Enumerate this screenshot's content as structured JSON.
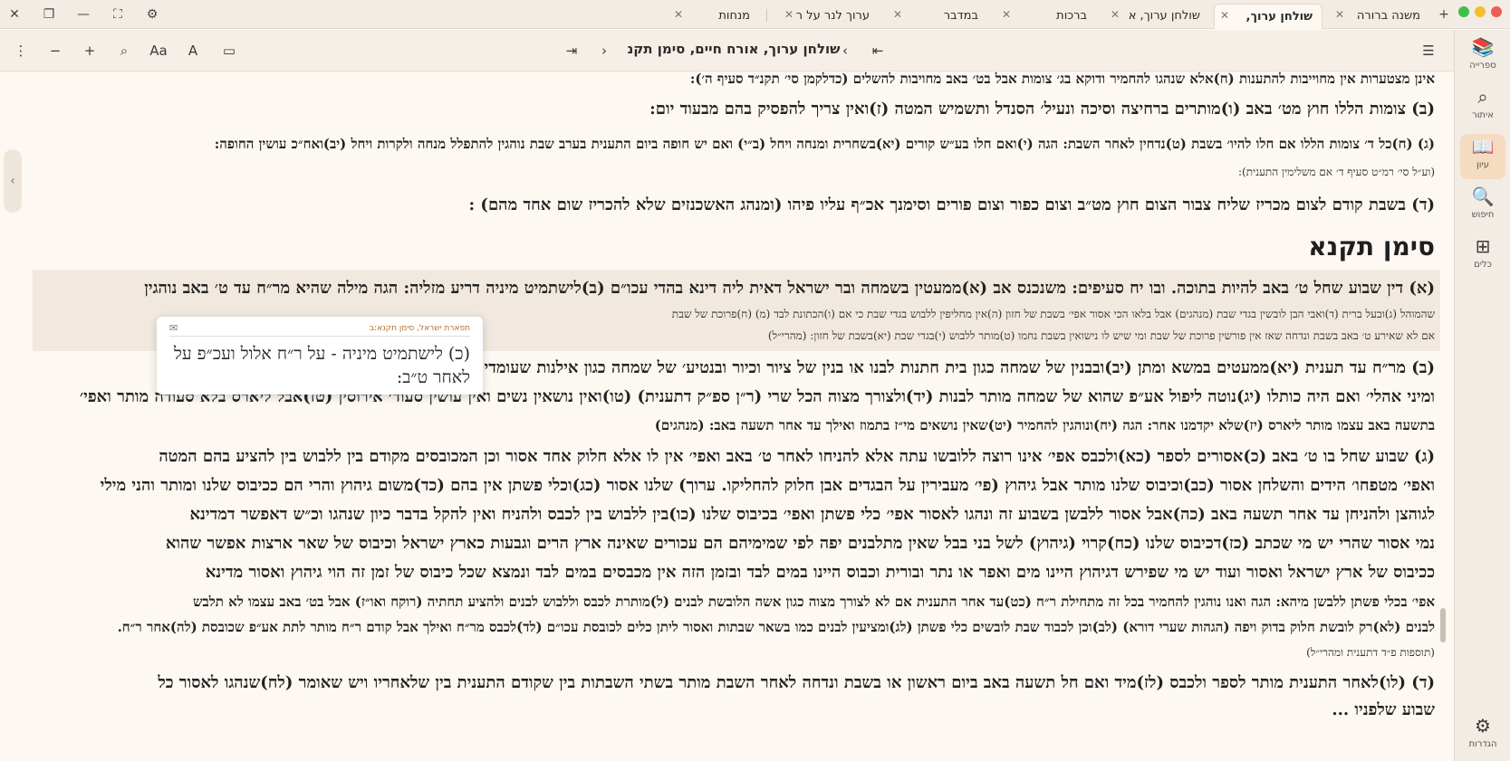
{
  "tabs": [
    {
      "label": "משנה ברורה",
      "close": "✕"
    },
    {
      "label": "שולחן ערוך,",
      "close": "✕",
      "active": true
    },
    {
      "label": "שולחן ערוך, א",
      "close": "✕"
    },
    {
      "label": "ברכות",
      "close": "✕"
    },
    {
      "label": "במדבר",
      "close": "✕"
    },
    {
      "label": "ערוך לנר על ר",
      "close": "✕"
    },
    {
      "label": "מנחות",
      "close": "✕"
    }
  ],
  "window_icons": {
    "add": "+",
    "settings": "⚙",
    "close": "✕",
    "minimize": "—",
    "fullscreen": "⛶",
    "restore": "❐"
  },
  "toolbar": {
    "book_title": "שולחן ערוך, אורח חיים, סימן תקנ",
    "menu_icon": "☰",
    "first": "⇤",
    "prev": "‹",
    "next": "›",
    "last": "⇥",
    "more": "⋮",
    "zoom_out": "−",
    "zoom_in": "+",
    "search": "⌕",
    "font_a": "Aa",
    "font_b": "A",
    "panel": "▭"
  },
  "rightbar": [
    {
      "icon": "📚",
      "label": "ספרייה"
    },
    {
      "icon": "⌕",
      "label": "איתור"
    },
    {
      "icon": "📖",
      "label": "עיון",
      "active": true
    },
    {
      "icon": "🔍",
      "label": "חיפוש"
    },
    {
      "icon": "⊞",
      "label": "כלים"
    },
    {
      "icon": "⚙",
      "label": "הגדרות"
    }
  ],
  "content": {
    "lines": [
      {
        "text": "אינן מצטערות אין מחוייבות להתענות (ח)אלא שנהגו להחמיר ודוקא בג׳ צומות אבל בט׳ באב מחויבות להשלים (כדלקמן סי׳ תקנ״ד סעיף ה׳):",
        "cls": "mid"
      },
      {
        "text": "(ב) צומות הללו חוץ מט׳ באב (ו)מותרים ברחיצה וסיכה ונעיל׳ הסנדל ותשמיש המטה (ז)ואין צריך להפסיק בהם מבעוד יום:",
        "cls": ""
      },
      {
        "text": "(ג) (ח)כל ד׳ צומות הללו אם חלו להיו׳ בשבת (ט)נדחין לאחר השבת: הגה (י)ואם חלו בע״ש קורים (יא)בשחרית ומנחה ויחל (ב״י) ואם יש חופה ביום התענית בערב שבת נוהגין להתפלל מנחה ולקרות ויחל (יב)ואח״כ עושין החופה:",
        "cls": "mid"
      },
      {
        "text": "(וע״ל סי׳ רמ״ט סעיף ד׳ אם משלימין התענית):",
        "cls": "small"
      },
      {
        "text": "(ד) בשבת קודם לצום מכריז שליח צבור הצום חוץ מט״ב וצום כפור וצום פורים וסימנך אכ״ף עליו פיהו (ומנהג האשכנזים שלא להכריז שום אחד מהם) :",
        "cls": ""
      },
      {
        "text": "(א) דין שבוע שחל ט׳ באב להיות בתוכה. ובו יח סעיפים: משנכנס אב (א)ממעטין בשמחה ובר ישראל דאית ליה דינא בהדי עכו״ם (ב)לישתמיט מיניה דריע מזליה: הגה מילה שהיא מר״ח עד ט׳ באב נוהגין",
        "cls": ""
      },
      {
        "text": "שהמוהל (ג)ובעל ברית (ד)ואבי הבן לובשין בגדי שבת (מנהגים) אבל בלאו הכי אסור אפי׳ בשבת של חזון (ה)אין מחליפין ללבוש בגדי שבת כי אם (ו)הכתונת לבד (מ) (ח)פרוכת של שבת",
        "cls": "small"
      },
      {
        "text": "אם לא שאירע ט׳ באב בשבת ונדחה שאז אין פורשין פרוכת של שבת ומי שיש לו נישואין בשבת נחמו (ט)מותר ללבוש (י)בגדי שבת (יא)בשבת של חזון: (מהרי״ל)",
        "cls": "small"
      },
      {
        "text": "(ב) מר״ח עד תענית (יא)ממעטים במשא ומתן (יב)ובבנין של שמחה כגון בית חתנות לבנו או בנין של ציור וכיור ובנטיע׳ של שמחה כגון אילנות שעומדים לצל או לטבע כגון הדס צילו או מיני הדס",
        "cls": ""
      },
      {
        "text": "ומיני אהלי׳ ואם היה כותלו (יג)נוטה ליפול אע״פ שהוא של שמחה מותר לבנות (יד)ולצורך מצוה הכל שרי (ר״ן ספ״ק דתענית) (טו)ואין נושאין נשים ואין עושין סעוד׳ אירוסין (טז)אבל ליארס בלא סעודה מותר ואפי׳",
        "cls": ""
      },
      {
        "text": "בתשעה באב עצמו מותר ליארס (יז)שלא יקדמנו אחר: הגה (יח)ונוהגין להחמיר (יט)שאין נושאים מי״ז בתמוז ואילך עד אחר תשעה באב: (מנהגים)",
        "cls": "mid"
      },
      {
        "text": "(ג) שבוע שחל בו ט׳ באב (כ)אסורים לספר (כא)ולכבס אפי׳ אינו רוצה ללובשו עתה אלא להניחו לאחר ט׳ באב ואפי׳ אין לו אלא חלוק אחד אסור וכן המכובסים מקודם בין ללבוש בין להציע בהם המטה",
        "cls": ""
      },
      {
        "text": "ואפי׳ מטפחו׳ הידים והשלחן אסור (כב)וכיבוס שלנו מותר אבל גיהוץ (פי׳ מעבירין על הבגדים אבן חלוק להחליקו. ערוך) שלנו אסור (כג)וכלי פשתן אין בהם (כד)משום גיהוץ והרי הם ככיבוס שלנו ומותר והני מילי",
        "cls": ""
      },
      {
        "text": "לגוהצן ולהניחן עד אחר תשעה באב (כה)אבל אסור ללבשן בשבוע זה ונהגו לאסור אפי׳ כלי פשתן ואפי׳ בכיבוס שלנו (כו)בין ללבוש בין לכבס ולהניח ואין להקל בדבר כיון שנהגו וכ״ש דאפשר דמדינא",
        "cls": ""
      },
      {
        "text": "נמי אסור שהרי יש מי שכתב (כז)דכיבוס שלנו (כח)קרוי (גיהוץ) לשל בני בבל שאין מתלבנים יפה לפי שמימיהם הם עכורים שאינה ארץ הרים וגבעות כארץ ישראל וכיבוס של שאר ארצות אפשר שהוא",
        "cls": ""
      },
      {
        "text": "ככיבוס של ארץ ישראל ואסור ועוד יש מי שפירש דגיהוץ היינו מים ואפר או נתר ובורית וכבוס היינו במים לבד ובזמן הזה אין מכבסים במים לבד ונמצא שכל כיבוס של זמן זה הוי גיהוץ ואסור מדינא",
        "cls": ""
      },
      {
        "text": "אפי׳ בכלי פשתן ללבשן מיהא: הגה ואנו נוהגין להחמיר בכל זה מתחילת ר״ח (כט)עד אחר התענית אם לא לצורך מצוה כגון אשה הלובשת לבנים (ל)מותרת לכבס וללבוש לבנים ולהציע תחתיה (רוקח ואו״ז) אבל בט׳ באב עצמו לא תלבש",
        "cls": "mid"
      },
      {
        "text": "לבנים (לא)רק לובשת חלוק בדוק ויפה (הגהות שערי דורא) (לב)וכן לכבוד שבת לובשים כלי פשתן (לג)ומציעין לבנים כמו בשאר שבתות ואסור ליתן כלים לכובסת עכו״ם (לד)לכבס מר״ח ואילך אבל קודם ר״ח מותר לתת אע״פ שכובסת (לה)אחר ר״ח.",
        "cls": "mid"
      },
      {
        "text": "(תוספות פ״ד דתענית ומהרי״ל)",
        "cls": "small"
      },
      {
        "text": "(ד) (לו)לאחר התענית מותר לספר ולכבס (לז)מיד ואם חל תשעה באב ביום ראשון או בשבת ונדחה לאחר השבת מותר בשתי השבתות בין שקודם התענית בין שלאחריו ויש שאומר (לח)שנהגו לאסור כל",
        "cls": ""
      },
      {
        "text": "שבוע שלפניו ...",
        "cls": ""
      }
    ],
    "section_title": "סימן תקנא"
  },
  "popup": {
    "title": "תפארת ישראל, סימן תקנא:ב",
    "icon": "✉",
    "text": "(כ) לישתמיט מיניה - על ר״ח אלול ועכ״פ על לאחר ט״ב:"
  },
  "left_handle": "‹"
}
